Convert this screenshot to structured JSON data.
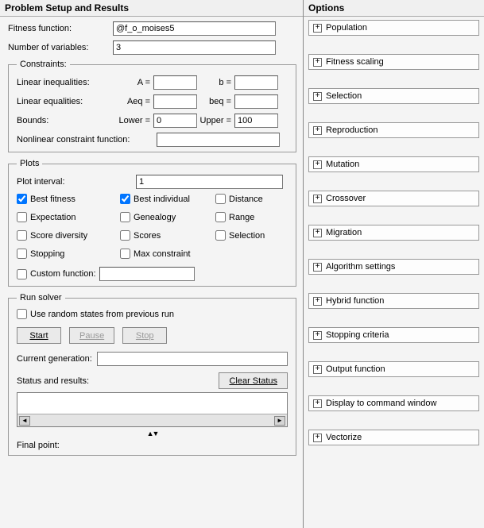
{
  "left": {
    "title": "Problem Setup and Results",
    "ff_label": "Fitness function:",
    "ff_value": "@f_o_moises5",
    "nv_label": "Number of variables:",
    "nv_value": "3",
    "constraints": {
      "legend": "Constraints:",
      "lin_ineq_label": "Linear inequalities:",
      "A_label": "A =",
      "A_value": "",
      "b_label": "b =",
      "b_value": "",
      "lin_eq_label": "Linear equalities:",
      "Aeq_label": "Aeq =",
      "Aeq_value": "",
      "beq_label": "beq =",
      "beq_value": "",
      "bounds_label": "Bounds:",
      "lower_label": "Lower =",
      "lower_value": "0",
      "upper_label": "Upper =",
      "upper_value": "100",
      "nlc_label": "Nonlinear constraint function:",
      "nlc_value": ""
    },
    "plots": {
      "legend": "Plots",
      "interval_label": "Plot interval:",
      "interval_value": "1",
      "best_fitness": "Best fitness",
      "best_individual": "Best individual",
      "distance": "Distance",
      "expectation": "Expectation",
      "genealogy": "Genealogy",
      "range": "Range",
      "score_diversity": "Score diversity",
      "scores": "Scores",
      "selection": "Selection",
      "stopping": "Stopping",
      "max_constraint": "Max constraint",
      "custom_label": "Custom function:",
      "custom_value": ""
    },
    "run": {
      "legend": "Run solver",
      "random_states": "Use random states from previous run",
      "start": "Start",
      "pause": "Pause",
      "stop": "Stop",
      "cg_label": "Current generation:",
      "sr_label": "Status and results:",
      "clear": "Clear Status",
      "fp_label": "Final point:"
    }
  },
  "right": {
    "title": "Options",
    "items": [
      "Population",
      "Fitness scaling",
      "Selection",
      "Reproduction",
      "Mutation",
      "Crossover",
      "Migration",
      "Algorithm settings",
      "Hybrid function",
      "Stopping criteria",
      "Output function",
      "Display to command window",
      "Vectorize"
    ]
  }
}
